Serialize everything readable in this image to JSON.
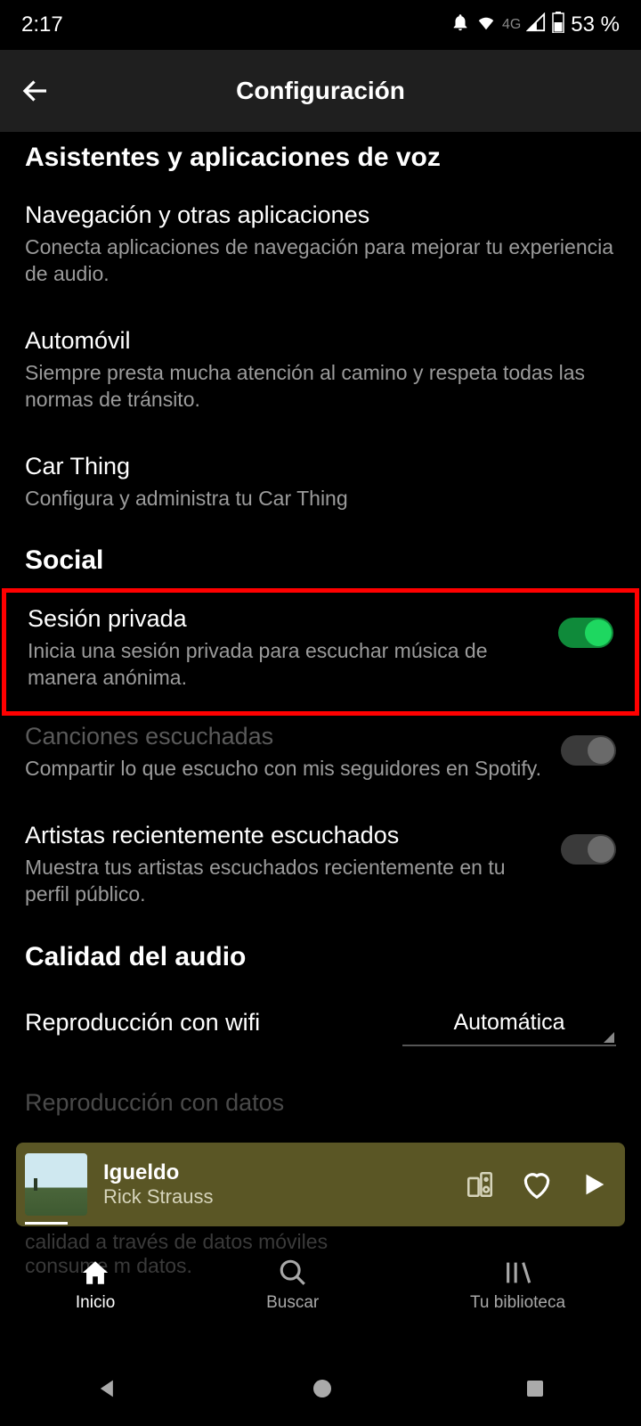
{
  "status": {
    "time": "2:17",
    "network": "4G",
    "battery": "53 %"
  },
  "header": {
    "title": "Configuración"
  },
  "sections": {
    "voice_header": "Asistentes y aplicaciones de voz",
    "nav_apps": {
      "title": "Navegación y otras aplicaciones",
      "sub": "Conecta aplicaciones de navegación para mejorar tu experiencia de audio."
    },
    "car": {
      "title": "Automóvil",
      "sub": "Siempre presta mucha atención al camino y respeta todas las normas de tránsito."
    },
    "car_thing": {
      "title": "Car Thing",
      "sub": "Configura y administra tu Car Thing"
    },
    "social_header": "Social",
    "private": {
      "title": "Sesión privada",
      "sub": "Inicia una sesión privada para escuchar música de manera anónima.",
      "on": true
    },
    "listened": {
      "title": "Canciones escuchadas",
      "sub": "Compartir lo que escucho con mis seguidores en Spotify.",
      "on": false
    },
    "recent_artists": {
      "title": "Artistas recientemente escuchados",
      "sub": "Muestra tus artistas escuchados recientemente en tu perfil público.",
      "on": false
    },
    "audio_header": "Calidad del audio",
    "wifi": {
      "title": "Reproducción con wifi",
      "value": "Automática"
    },
    "cut_title": "Reproducción con datos",
    "cut_sub_line1": "calidad a través de datos móviles",
    "cut_sub_line2": "consume m        datos."
  },
  "miniplayer": {
    "title": "Igueldo",
    "artist": "Rick Strauss"
  },
  "nav": {
    "home": "Inicio",
    "search": "Buscar",
    "library": "Tu biblioteca"
  }
}
